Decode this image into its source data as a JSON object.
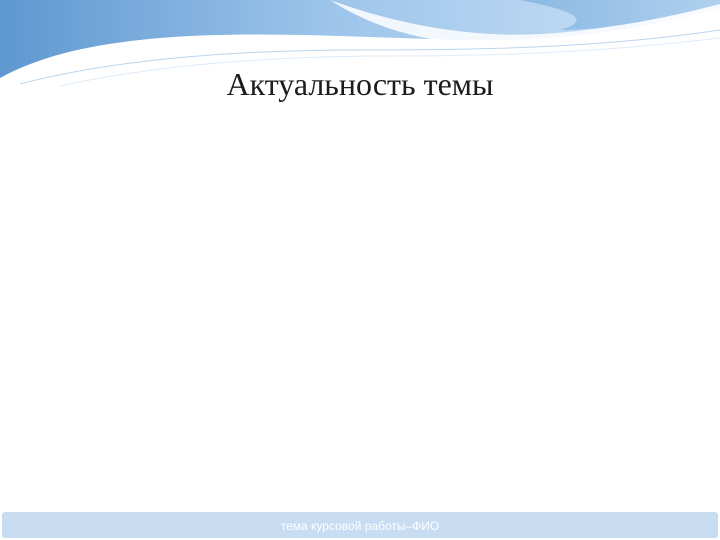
{
  "slide": {
    "title": "Актуальность темы",
    "footer": "тема курсовой работы–ФИО"
  },
  "theme": {
    "wave_dark": "#6fa4d6",
    "wave_light": "#b9d6f0",
    "footer_bg": "#c8dcf2",
    "footer_text": "#ffffff",
    "title_color": "#1c1c1c"
  }
}
